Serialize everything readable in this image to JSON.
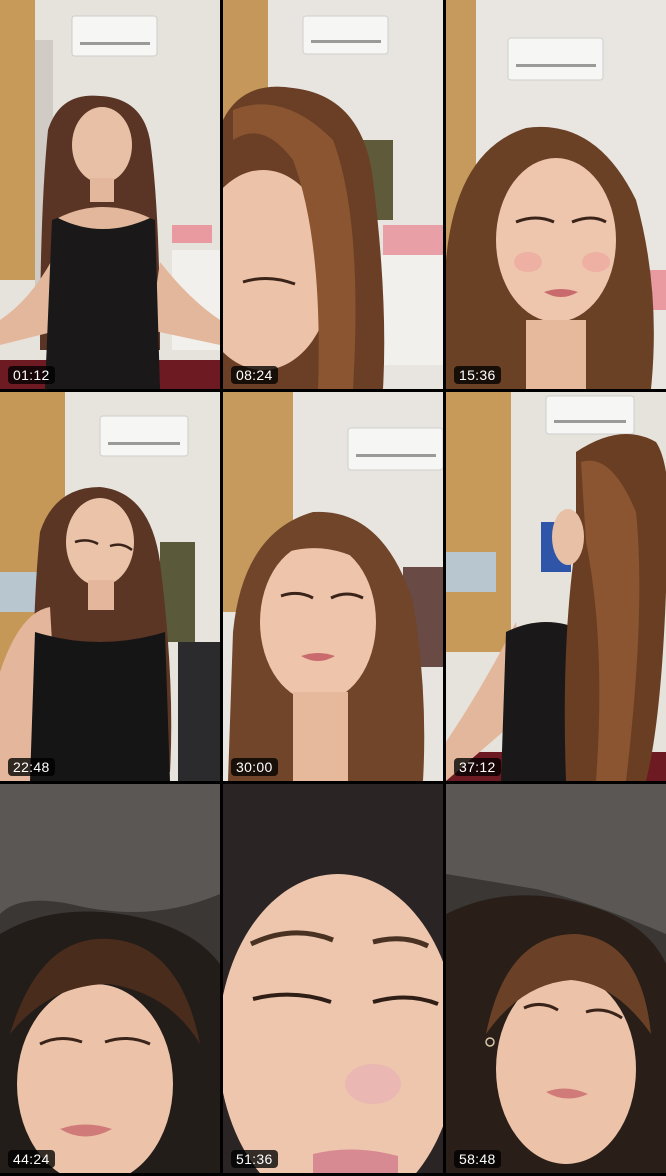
{
  "frames": [
    {
      "timestamp": "01:12",
      "scene": "room-upper-body"
    },
    {
      "timestamp": "08:24",
      "scene": "face-closeup-side"
    },
    {
      "timestamp": "15:36",
      "scene": "face-closeup-front"
    },
    {
      "timestamp": "22:48",
      "scene": "room-upper-body"
    },
    {
      "timestamp": "30:00",
      "scene": "face-closeup-front"
    },
    {
      "timestamp": "37:12",
      "scene": "room-turned-away"
    },
    {
      "timestamp": "44:24",
      "scene": "lying-down"
    },
    {
      "timestamp": "51:36",
      "scene": "face-extreme-closeup"
    },
    {
      "timestamp": "58:48",
      "scene": "lying-down"
    }
  ]
}
